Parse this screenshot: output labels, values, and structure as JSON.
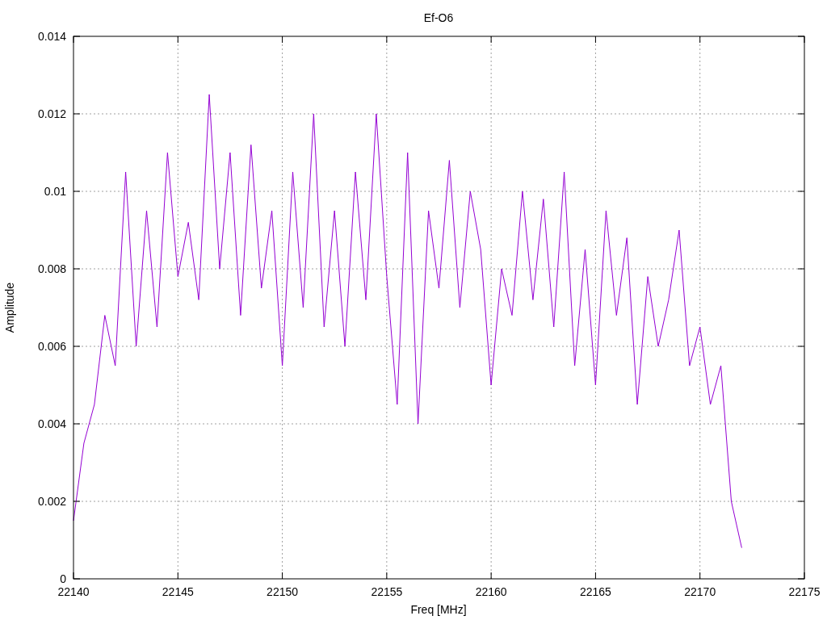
{
  "plot": {
    "chart_data": {
      "type": "line",
      "title": "Ef-O6",
      "xlabel": "Freq [MHz]",
      "ylabel": "Amplitude",
      "xlim": [
        22140,
        22175
      ],
      "ylim": [
        0,
        0.014
      ],
      "xticks": [
        22140,
        22145,
        22150,
        22155,
        22160,
        22165,
        22170,
        22175
      ],
      "yticks": [
        {
          "value": 0,
          "label": "0"
        },
        {
          "value": 0.002,
          "label": "0.002"
        },
        {
          "value": 0.004,
          "label": "0.004"
        },
        {
          "value": 0.006,
          "label": "0.006"
        },
        {
          "value": 0.008,
          "label": "0.008"
        },
        {
          "value": 0.01,
          "label": "0.01"
        },
        {
          "value": 0.012,
          "label": "0.012"
        },
        {
          "value": 0.014,
          "label": "0.014"
        }
      ],
      "x": [
        22140,
        22140.5,
        22141,
        22141.5,
        22142,
        22142.5,
        22143,
        22143.5,
        22144,
        22144.5,
        22145,
        22145.5,
        22146,
        22146.5,
        22147,
        22147.5,
        22148,
        22148.5,
        22149,
        22149.5,
        22150,
        22150.5,
        22151,
        22151.5,
        22152,
        22152.5,
        22153,
        22153.5,
        22154,
        22154.5,
        22155,
        22155.5,
        22156,
        22156.5,
        22157,
        22157.5,
        22158,
        22158.5,
        22159,
        22159.5,
        22160,
        22160.5,
        22161,
        22161.5,
        22162,
        22162.5,
        22163,
        22163.5,
        22164,
        22164.5,
        22165,
        22165.5,
        22166,
        22166.5,
        22167,
        22167.5,
        22168,
        22168.5,
        22169,
        22169.5,
        22170,
        22170.5,
        22171,
        22171.5,
        22172
      ],
      "grid": true,
      "series": [
        {
          "color": "#9400d3",
          "values": [
            0.0015,
            0.0035,
            0.0045,
            0.0068,
            0.0055,
            0.0105,
            0.006,
            0.0095,
            0.0065,
            0.011,
            0.0078,
            0.0092,
            0.0072,
            0.0125,
            0.008,
            0.011,
            0.0068,
            0.0112,
            0.0075,
            0.0095,
            0.0055,
            0.0105,
            0.007,
            0.012,
            0.0065,
            0.0095,
            0.006,
            0.0105,
            0.0072,
            0.012,
            0.0078,
            0.0045,
            0.011,
            0.004,
            0.0095,
            0.0075,
            0.0108,
            0.007,
            0.01,
            0.0085,
            0.005,
            0.008,
            0.0068,
            0.01,
            0.0072,
            0.0098,
            0.0065,
            0.0105,
            0.0055,
            0.0085,
            0.005,
            0.0095,
            0.0068,
            0.0088,
            0.0045,
            0.0078,
            0.006,
            0.0072,
            0.009,
            0.0055,
            0.0065,
            0.0045,
            0.0055,
            0.002,
            0.0008
          ]
        }
      ]
    }
  }
}
